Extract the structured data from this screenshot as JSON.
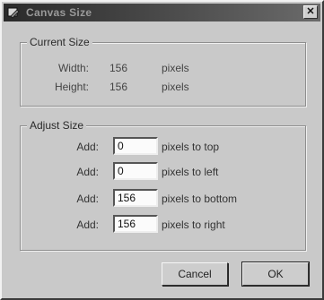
{
  "window": {
    "title": "Canvas Size",
    "close_glyph": "✕"
  },
  "current_size": {
    "legend": "Current Size",
    "width_label": "Width:",
    "width_value": "156",
    "width_unit": "pixels",
    "height_label": "Height:",
    "height_value": "156",
    "height_unit": "pixels"
  },
  "adjust_size": {
    "legend": "Adjust Size",
    "rows": [
      {
        "label": "Add:",
        "value": "0",
        "suffix": "pixels to top"
      },
      {
        "label": "Add:",
        "value": "0",
        "suffix": "pixels to left"
      },
      {
        "label": "Add:",
        "value": "156",
        "suffix": "pixels to bottom"
      },
      {
        "label": "Add:",
        "value": "156",
        "suffix": "pixels to right"
      }
    ]
  },
  "buttons": {
    "cancel": "Cancel",
    "ok": "OK"
  }
}
